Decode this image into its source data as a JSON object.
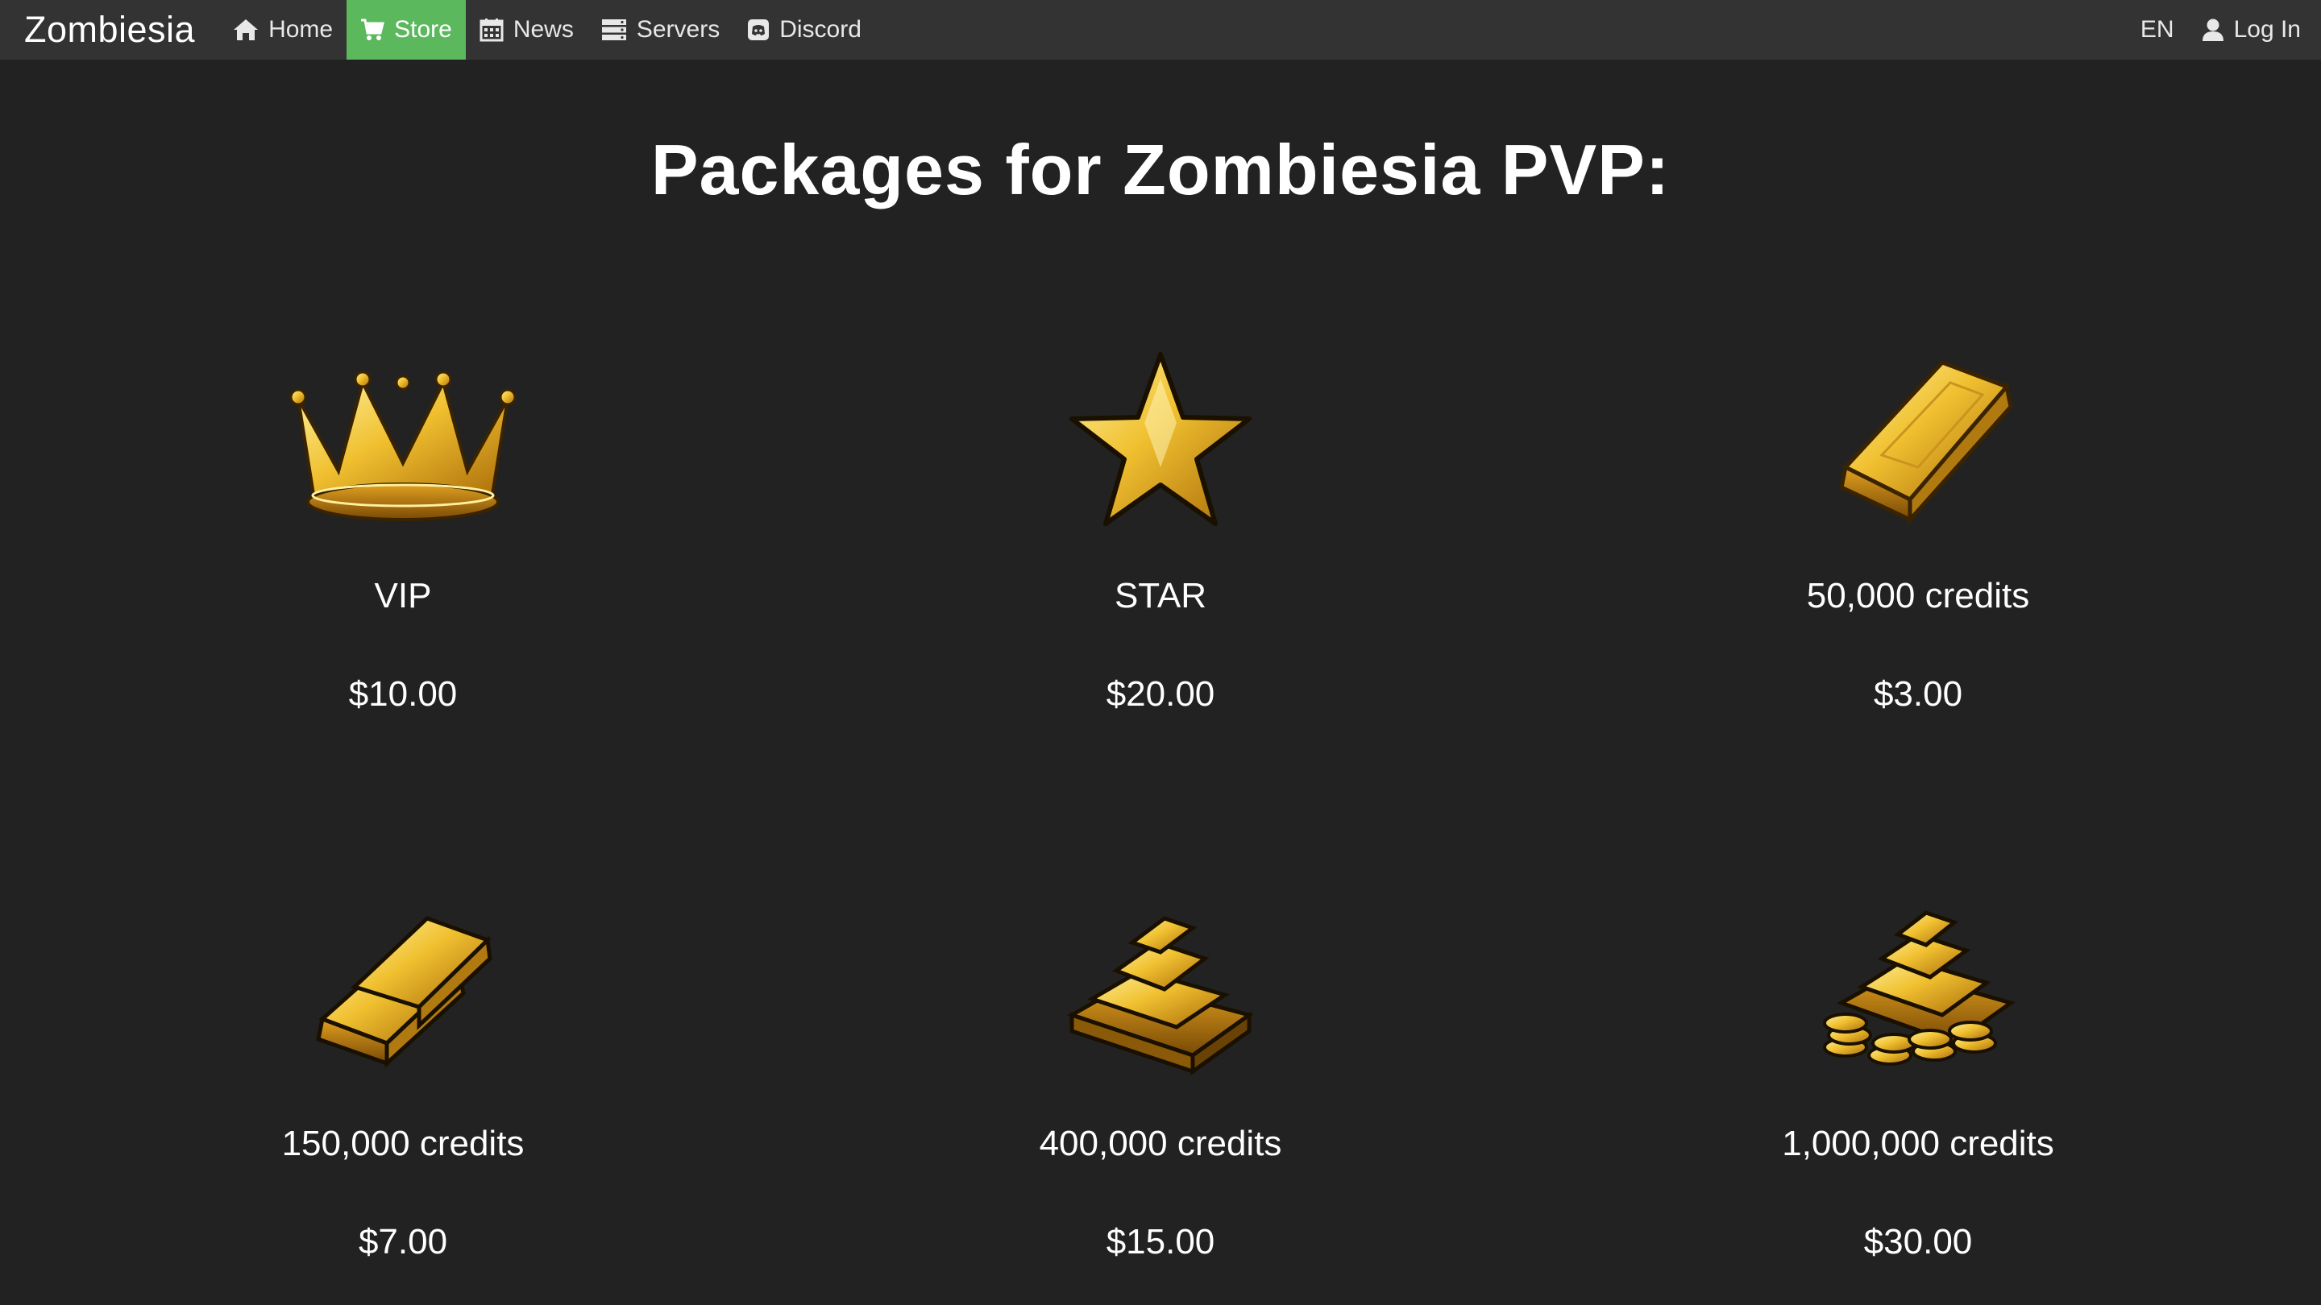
{
  "nav": {
    "brand": "Zombiesia",
    "items": [
      {
        "label": "Home",
        "icon": "home-icon",
        "active": false
      },
      {
        "label": "Store",
        "icon": "cart-icon",
        "active": true
      },
      {
        "label": "News",
        "icon": "calendar-icon",
        "active": false
      },
      {
        "label": "Servers",
        "icon": "server-icon",
        "active": false
      },
      {
        "label": "Discord",
        "icon": "discord-icon",
        "active": false
      }
    ],
    "language": "EN",
    "login": "Log In"
  },
  "page": {
    "title": "Packages for Zombiesia PVP:"
  },
  "packages": [
    {
      "name": "VIP",
      "price": "$10.00",
      "icon": "crown-icon"
    },
    {
      "name": "STAR",
      "price": "$20.00",
      "icon": "star-icon"
    },
    {
      "name": "50,000 credits",
      "price": "$3.00",
      "icon": "gold-bar-icon"
    },
    {
      "name": "150,000 credits",
      "price": "$7.00",
      "icon": "gold-bars-icon"
    },
    {
      "name": "400,000 credits",
      "price": "$15.00",
      "icon": "gold-pile-icon"
    },
    {
      "name": "1,000,000 credits",
      "price": "$30.00",
      "icon": "gold-treasure-icon"
    }
  ],
  "colors": {
    "background": "#222222",
    "navbar": "#333333",
    "active_tab": "#5cb85c",
    "gold": "#e8b923"
  }
}
